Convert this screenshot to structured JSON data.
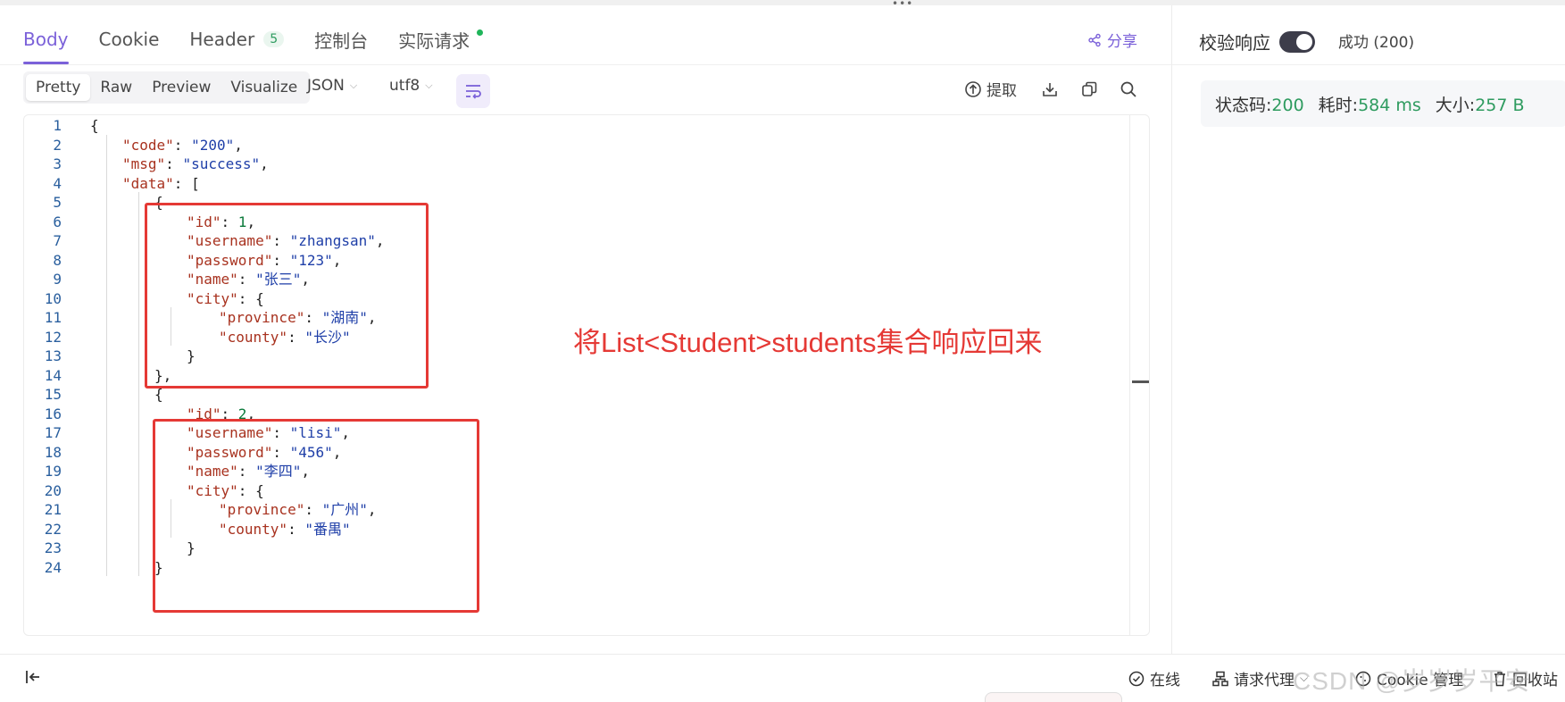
{
  "tabs": [
    {
      "label": "Body"
    },
    {
      "label": "Cookie"
    },
    {
      "label": "Header",
      "badge": "5"
    },
    {
      "label": "控制台"
    },
    {
      "label": "实际请求"
    }
  ],
  "share_label": "分享",
  "view_modes": [
    "Pretty",
    "Raw",
    "Preview",
    "Visualize"
  ],
  "format_select": "JSON",
  "encoding_select": "utf8",
  "extract_label": "提取",
  "verify_label": "校验响应",
  "verify_enabled": true,
  "result_status": "成功 (200)",
  "stats": {
    "status_label": "状态码:",
    "status_value": "200",
    "time_label": "耗时:",
    "time_value": "584 ms",
    "size_label": "大小:",
    "size_value": "257 B"
  },
  "annotation": "将List<Student>students集合响应回来",
  "code_lines": [
    [
      "p:{"
    ],
    [
      "k:\"code\"",
      "p:: ",
      "s:\"200\"",
      "p:,"
    ],
    [
      "k:\"msg\"",
      "p:: ",
      "s:\"success\"",
      "p:,"
    ],
    [
      "k:\"data\"",
      "p:: ["
    ],
    [
      "p:{"
    ],
    [
      "k:\"id\"",
      "p:: ",
      "n:1",
      "p:,"
    ],
    [
      "k:\"username\"",
      "p:: ",
      "s:\"zhangsan\"",
      "p:,"
    ],
    [
      "k:\"password\"",
      "p:: ",
      "s:\"123\"",
      "p:,"
    ],
    [
      "k:\"name\"",
      "p:: ",
      "s:\"张三\"",
      "p:,"
    ],
    [
      "k:\"city\"",
      "p:: {"
    ],
    [
      "k:\"province\"",
      "p:: ",
      "s:\"湖南\"",
      "p:,"
    ],
    [
      "k:\"county\"",
      "p:: ",
      "s:\"长沙\""
    ],
    [
      "p:}"
    ],
    [
      "p:},"
    ],
    [
      "p:{"
    ],
    [
      "k:\"id\"",
      "p:: ",
      "n:2",
      "p:,"
    ],
    [
      "k:\"username\"",
      "p:: ",
      "s:\"lisi\"",
      "p:,"
    ],
    [
      "k:\"password\"",
      "p:: ",
      "s:\"456\"",
      "p:,"
    ],
    [
      "k:\"name\"",
      "p:: ",
      "s:\"李四\"",
      "p:,"
    ],
    [
      "k:\"city\"",
      "p:: {"
    ],
    [
      "k:\"province\"",
      "p:: ",
      "s:\"广州\"",
      "p:,"
    ],
    [
      "k:\"county\"",
      "p:: ",
      "s:\"番禺\""
    ],
    [
      "p:}"
    ],
    [
      "p:}"
    ]
  ],
  "line_indents": [
    0,
    1,
    1,
    1,
    2,
    3,
    3,
    3,
    3,
    3,
    4,
    4,
    3,
    2,
    2,
    3,
    3,
    3,
    3,
    3,
    4,
    4,
    3,
    2
  ],
  "bottom": {
    "online": "在线",
    "proxy": "请求代理",
    "cookie_mgmt": "Cookie 管理",
    "recycle": "回收站"
  },
  "watermark": "CSDN @岁岁岁平安",
  "colors": {
    "accent": "#7b61d9",
    "success": "#2e9b5f",
    "annotation": "#e53935"
  }
}
